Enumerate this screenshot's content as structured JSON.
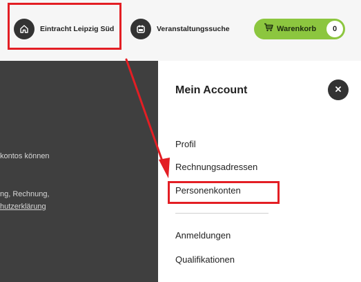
{
  "header": {
    "home_label": "Eintracht Leipzig Süd",
    "events_label": "Veranstaltungssuche",
    "cart_label": "Warenkorb",
    "cart_count": "0"
  },
  "background": {
    "line1": "kontos können",
    "line2": "ng, Rechnung,",
    "line3": "hutzerklärung"
  },
  "panel": {
    "title": "Mein Account",
    "items": [
      "Profil",
      "Rechnungsadressen",
      "Personenkonten",
      "Anmeldungen",
      "Qualifikationen"
    ]
  },
  "colors": {
    "accent_green": "#8cc63f",
    "highlight_red": "#e31e24",
    "dark": "#333333"
  },
  "icons": {
    "home": "home-icon",
    "events": "calendar-icon",
    "cart": "cart-icon",
    "close": "close-icon"
  }
}
